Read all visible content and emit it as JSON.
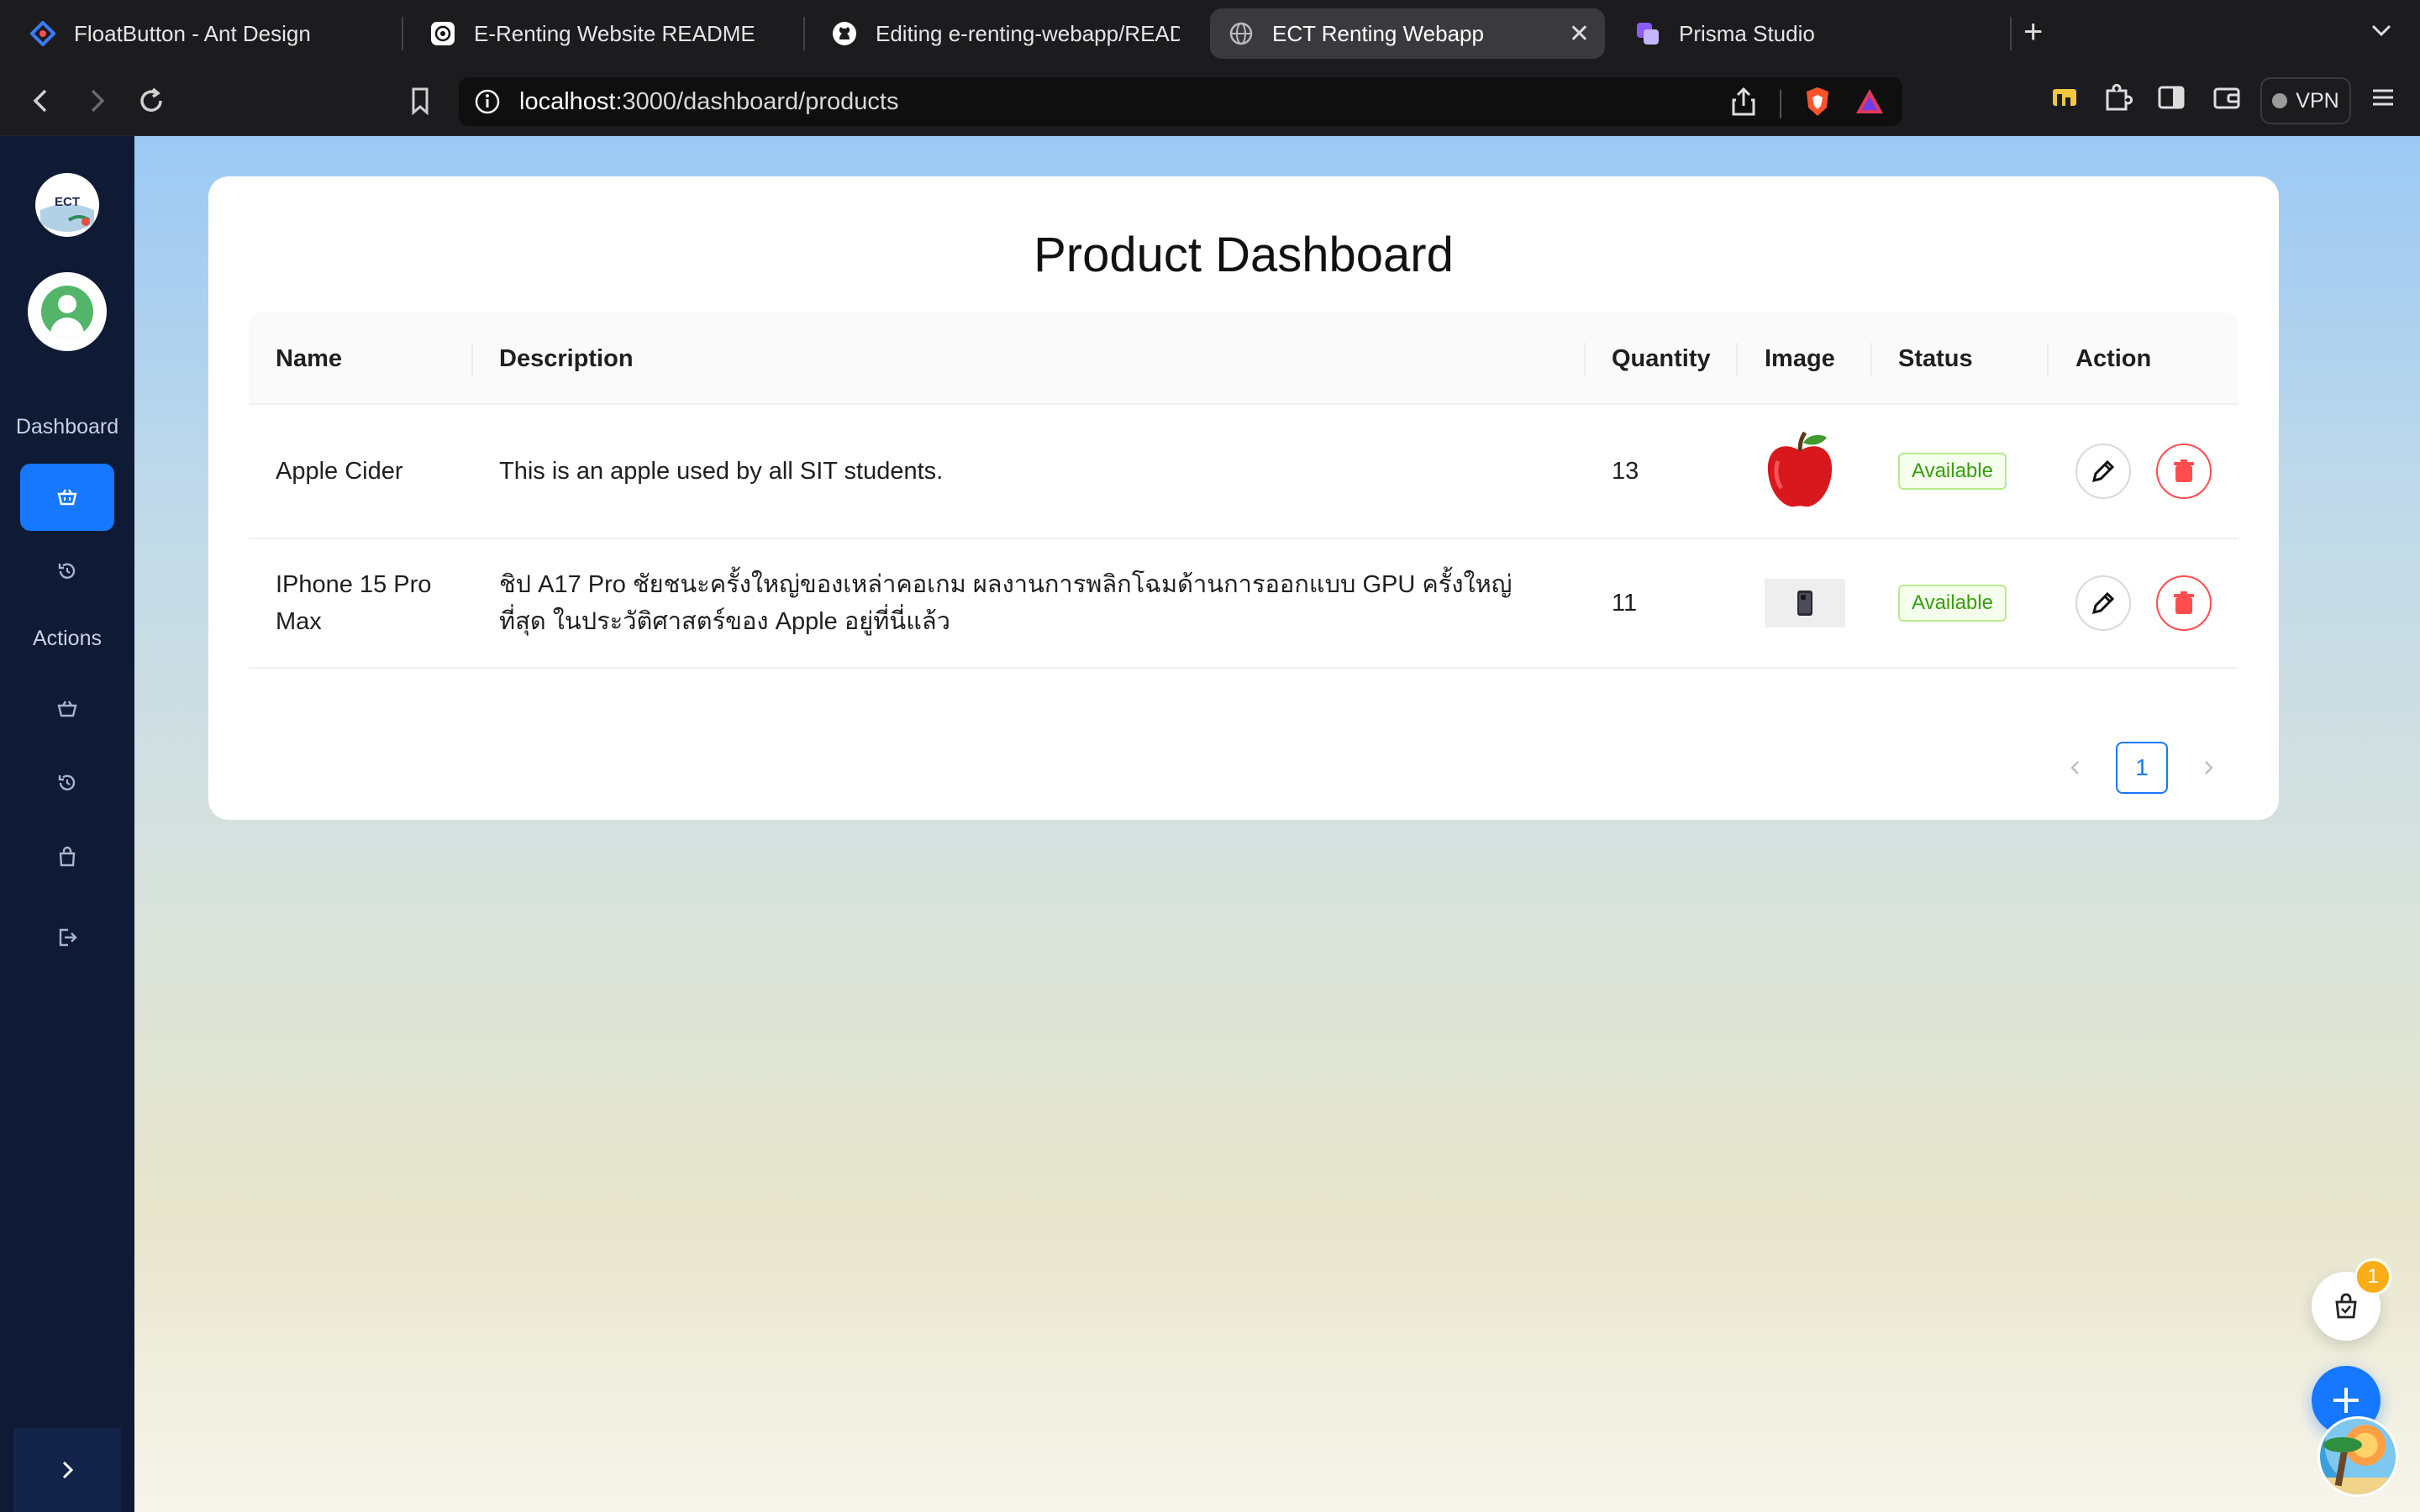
{
  "browser": {
    "tabs": [
      {
        "title": "FloatButton - Ant Design",
        "active": false
      },
      {
        "title": "E-Renting Website README",
        "active": false
      },
      {
        "title": "Editing e-renting-webapp/READM",
        "active": false
      },
      {
        "title": "ECT Renting Webapp",
        "active": true
      },
      {
        "title": "Prisma Studio",
        "active": false
      }
    ],
    "url_host": "localhost",
    "url_rest": ":3000/dashboard/products",
    "vpn_label": "VPN"
  },
  "sidebar": {
    "logo_text": "ECT",
    "section_dashboard": "Dashboard",
    "section_actions": "Actions"
  },
  "dashboard": {
    "title": "Product Dashboard",
    "columns": [
      "Name",
      "Description",
      "Quantity",
      "Image",
      "Status",
      "Action"
    ],
    "rows": [
      {
        "name": "Apple Cider",
        "description": "This is an apple used by all SIT students.",
        "quantity": "13",
        "image": "apple-image",
        "status": "Available"
      },
      {
        "name": "IPhone 15 Pro Max",
        "description": "ชิป A17 Pro ชัยชนะครั้งใหญ่ของเหล่าคอเกม ผลงานการพลิกโฉมด้านการออกแบบ GPU ครั้งใหญ่ที่สุด ในประวัติศาสตร์ของ Apple อยู่ที่นี่แล้ว",
        "quantity": "11",
        "image": "phone-image",
        "status": "Available"
      }
    ],
    "pagination": {
      "current_page": "1"
    }
  },
  "float_buttons": {
    "cart_badge": "1"
  },
  "colors": {
    "accent": "#1677ff",
    "sidebar_bg": "#0f1b35",
    "status_green": "#389e0d",
    "danger": "#ff4d4f"
  }
}
